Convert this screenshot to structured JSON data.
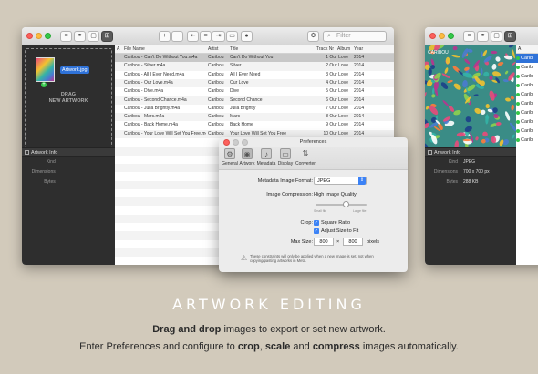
{
  "left_window": {
    "toolbar": {
      "add": "+",
      "remove": "−",
      "search_placeholder": "Filter"
    },
    "drop_file_chip": "Artwork.jpg",
    "drag_label_line1": "DRAG",
    "drag_label_line2": "NEW ARTWORK",
    "artwork_info_header": "Artwork Info",
    "info_rows": [
      {
        "key": "Kind",
        "value": ""
      },
      {
        "key": "Dimensions",
        "value": ""
      },
      {
        "key": "Bytes",
        "value": ""
      }
    ],
    "columns": [
      "A",
      "File Name",
      "Artist",
      "Title",
      "Track Nr",
      "Album",
      "Year"
    ],
    "rows": [
      [
        "Caribou - Can't Do Without You.m4a",
        "Caribou",
        "Can't Do Without You",
        "1 Our Love",
        "2014"
      ],
      [
        "Caribou - Silver.m4a",
        "Caribou",
        "Silver",
        "2 Our Love",
        "2014"
      ],
      [
        "Caribou - All I Ever Need.m4a",
        "Caribou",
        "All I Ever Need",
        "3 Our Love",
        "2014"
      ],
      [
        "Caribou - Our Love.m4a",
        "Caribou",
        "Our Love",
        "4 Our Love",
        "2014"
      ],
      [
        "Caribou - Dive.m4a",
        "Caribou",
        "Dive",
        "5 Our Love",
        "2014"
      ],
      [
        "Caribou - Second Chance.m4a",
        "Caribou",
        "Second Chance",
        "6 Our Love",
        "2014"
      ],
      [
        "Caribou - Julia Brightly.m4a",
        "Caribou",
        "Julia Brightly",
        "7 Our Love",
        "2014"
      ],
      [
        "Caribou - Mars.m4a",
        "Caribou",
        "Mars",
        "8 Our Love",
        "2014"
      ],
      [
        "Caribou - Back Home.m4a",
        "Caribou",
        "Back Home",
        "9 Our Love",
        "2014"
      ],
      [
        "Caribou - Your Love Will Set You Free.m4a",
        "Caribou",
        "Your Love Will Set You Free",
        "10 Our Love",
        "2014"
      ]
    ]
  },
  "prefs": {
    "title": "Preferences",
    "tabs": [
      "General",
      "Artwork",
      "Metadata",
      "Display",
      "Converter"
    ],
    "format_label": "Metadata Image Format:",
    "format_value": "JPEG",
    "compression_label": "Image Compression:",
    "compression_value": "High Image Quality",
    "small_file": "Small file",
    "large_file": "Large file",
    "compression_level": 0.6,
    "crop_label": "Crop:",
    "square_ratio": "Square Ratio",
    "adjust_size": "Adjust Size to Fit",
    "max_size_label": "Max Size:",
    "max_w": "800",
    "x_sep": "×",
    "max_h": "800",
    "pixels": "pixels",
    "footnote": "These constraints will only be applied when a new image is set, not when copying/pasting artworks in Meta."
  },
  "right_window": {
    "cover_word": "CARIBOU",
    "artwork_info_header": "Artwork Info",
    "info_rows": [
      {
        "key": "Kind",
        "value": "JPEG"
      },
      {
        "key": "Dimensions",
        "value": "700 x 700 px"
      },
      {
        "key": "Bytes",
        "value": "288 KB"
      }
    ],
    "list_header": "A",
    "list_items": [
      "Carib",
      "Carib",
      "Carib",
      "Carib",
      "Carib",
      "Carib",
      "Carib",
      "Carib",
      "Carib",
      "Carib"
    ]
  },
  "caption": {
    "heading": "ARTWORK EDITING",
    "line1_bold": "Drag and drop",
    "line1_rest": " images to export or set new artwork.",
    "line2_a": "Enter Preferences and configure to ",
    "line2_crop": "crop",
    "line2_b": ", ",
    "line2_scale": "scale",
    "line2_c": " and ",
    "line2_compress": "compress",
    "line2_d": " images automatically."
  },
  "colors": {
    "background": "#d2cabb",
    "sidebar": "#2e2e2e",
    "accent": "#3b82f6",
    "selection": "#2f72d8"
  }
}
